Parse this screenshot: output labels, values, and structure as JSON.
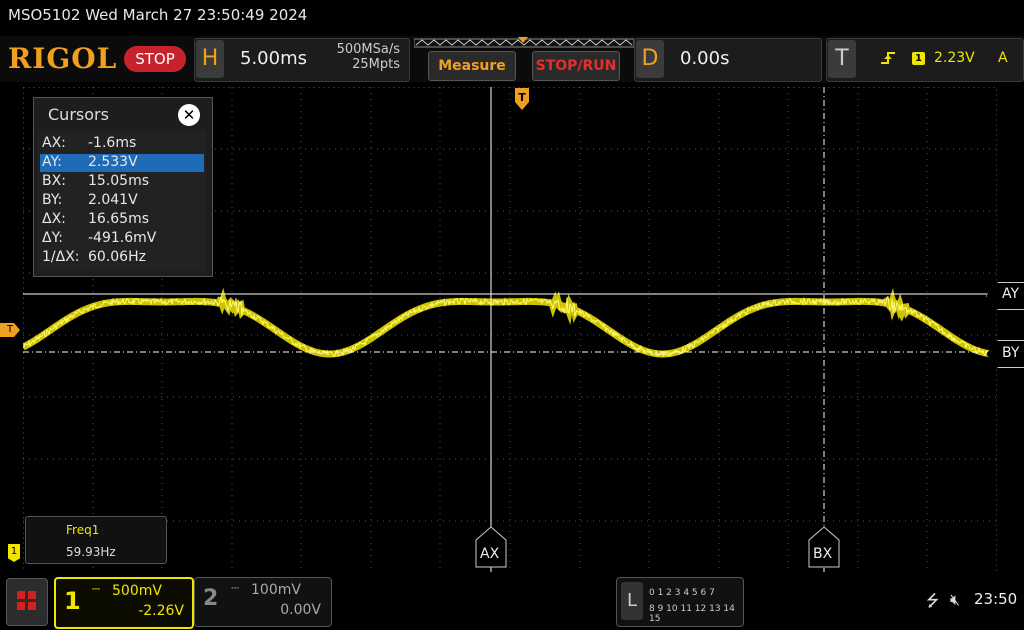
{
  "titlebar": {
    "text": "MSO5102  Wed March 27 23:50:49 2024"
  },
  "logo": "RIGOL",
  "run_state": "STOP",
  "horizontal": {
    "letter": "H",
    "timebase": "5.00ms",
    "sample_rate": "500MSa/s",
    "memory_depth": "25Mpts"
  },
  "buttons": {
    "measure": "Measure",
    "stop_run": "STOP/RUN"
  },
  "delay": {
    "letter": "D",
    "value": "0.00s"
  },
  "trigger": {
    "letter": "T",
    "channel": "1",
    "level": "2.23V",
    "mode": "A"
  },
  "cursors": {
    "title": "Cursors",
    "rows": [
      {
        "key": "AX:",
        "value": "-1.6ms"
      },
      {
        "key": "AY:",
        "value": "2.533V"
      },
      {
        "key": "BX:",
        "value": "15.05ms"
      },
      {
        "key": "BY:",
        "value": "2.041V"
      },
      {
        "key": "ΔX:",
        "value": "16.65ms"
      },
      {
        "key": "ΔY:",
        "value": "-491.6mV"
      },
      {
        "key": "1/ΔX:",
        "value": "60.06Hz"
      }
    ],
    "selected_index": 1,
    "labels": {
      "ay": "AY",
      "by": "BY",
      "ax": "AX",
      "bx": "BX"
    }
  },
  "markers": {
    "trigger_level": "T",
    "channel1": "1"
  },
  "measurement": {
    "name": "Freq1",
    "value": "59.93Hz"
  },
  "channel1": {
    "number": "1",
    "scale": "500mV",
    "offset": "-2.26V",
    "color": "#f2e500"
  },
  "channel2": {
    "number": "2",
    "scale": "100mV",
    "offset": "0.00V"
  },
  "logic": {
    "letter": "L",
    "row1": "0 1 2 3  4 5 6 7",
    "row2": "8 9 10 11 12 13 14 15"
  },
  "status": {
    "time": "23:50"
  },
  "colors": {
    "accent": "#f0a020",
    "stop": "#c8232c",
    "trace": "#f2e500",
    "selected": "#1e6bb8"
  }
}
